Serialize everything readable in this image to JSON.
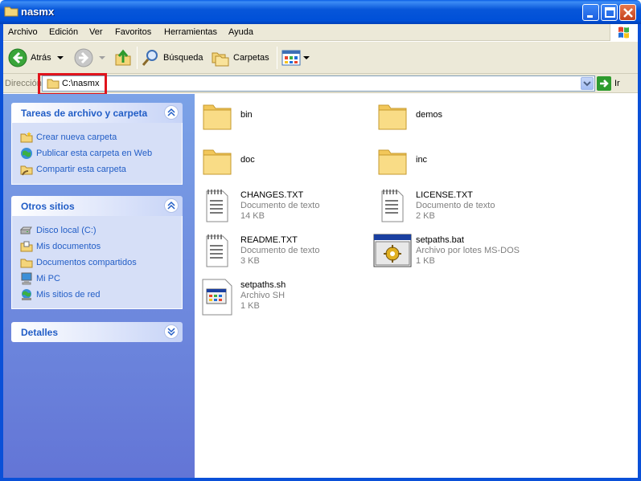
{
  "window": {
    "title": "nasmx"
  },
  "menu": {
    "items": [
      "Archivo",
      "Edición",
      "Ver",
      "Favoritos",
      "Herramientas",
      "Ayuda"
    ]
  },
  "toolbar": {
    "back_label": "Atrás",
    "search_label": "Búsqueda",
    "folders_label": "Carpetas"
  },
  "address": {
    "label": "Dirección",
    "value": "C:\\nasmx",
    "go_label": "Ir"
  },
  "sidebar": {
    "tasks": {
      "title": "Tareas de archivo y carpeta",
      "links": [
        {
          "label": "Crear nueva carpeta",
          "icon": "new-folder-icon"
        },
        {
          "label": "Publicar esta carpeta en Web",
          "icon": "publish-web-icon"
        },
        {
          "label": "Compartir esta carpeta",
          "icon": "share-folder-icon"
        }
      ]
    },
    "places": {
      "title": "Otros sitios",
      "links": [
        {
          "label": "Disco local (C:)",
          "icon": "local-disk-icon"
        },
        {
          "label": "Mis documentos",
          "icon": "my-documents-icon"
        },
        {
          "label": "Documentos compartidos",
          "icon": "shared-documents-icon"
        },
        {
          "label": "Mi PC",
          "icon": "my-computer-icon"
        },
        {
          "label": "Mis sitios de red",
          "icon": "network-places-icon"
        }
      ]
    },
    "details": {
      "title": "Detalles"
    }
  },
  "files": [
    {
      "name": "bin",
      "type": "",
      "size": "",
      "icon": "folder-icon"
    },
    {
      "name": "demos",
      "type": "",
      "size": "",
      "icon": "folder-icon"
    },
    {
      "name": "doc",
      "type": "",
      "size": "",
      "icon": "folder-icon"
    },
    {
      "name": "inc",
      "type": "",
      "size": "",
      "icon": "folder-icon"
    },
    {
      "name": "CHANGES.TXT",
      "type": "Documento de texto",
      "size": "14 KB",
      "icon": "text-document-icon"
    },
    {
      "name": "LICENSE.TXT",
      "type": "Documento de texto",
      "size": "2 KB",
      "icon": "text-document-icon"
    },
    {
      "name": "README.TXT",
      "type": "Documento de texto",
      "size": "3 KB",
      "icon": "text-document-icon"
    },
    {
      "name": "setpaths.bat",
      "type": "Archivo por lotes MS-DOS",
      "size": "1 KB",
      "icon": "batch-file-icon"
    },
    {
      "name": "setpaths.sh",
      "type": "Archivo SH",
      "size": "1 KB",
      "icon": "generic-file-icon"
    }
  ],
  "colors": {
    "titlebar": "#0050d8",
    "link": "#215dc6",
    "highlight": "#e0141c"
  }
}
